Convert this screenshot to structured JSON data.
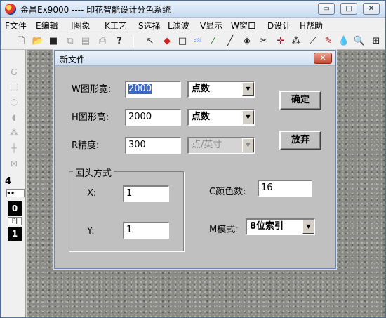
{
  "app": {
    "title": "金昌Ex9000 ---- 印花智能设计分色系统",
    "window_controls": {
      "minimize": "▭",
      "maximize": "□",
      "close": "✕"
    }
  },
  "menu": [
    {
      "label": "F文件"
    },
    {
      "label": "E编辑"
    },
    {
      "label": "I图象"
    },
    {
      "label": "K工艺"
    },
    {
      "label": "S选择"
    },
    {
      "label": "L滤波"
    },
    {
      "label": "V显示"
    },
    {
      "label": "W窗口"
    },
    {
      "label": "D设计"
    },
    {
      "label": "H帮助"
    }
  ],
  "toolbar": {
    "icons": [
      "new-file-icon",
      "open-folder-icon",
      "save-icon",
      "copy-icon",
      "paste-icon",
      "print-icon",
      "help-icon",
      "pointer-icon",
      "eraser-icon",
      "rectangle-icon",
      "brush-icon",
      "pen-icon",
      "line-icon",
      "fill-icon",
      "scissors-icon",
      "crosshair-icon",
      "spray-icon",
      "knife-icon",
      "pencil-icon",
      "dropper-icon",
      "zoom-icon",
      "grid-icon"
    ]
  },
  "side_panel": {
    "first_tool_label": "G",
    "brush_size": "4",
    "value_a": "0",
    "pl_label": "P|",
    "value_b": "1"
  },
  "dialog": {
    "title": "新文件",
    "close_label": "✕",
    "width_label": "W图形宽:",
    "width_value": "2000",
    "width_unit": "点数",
    "height_label": "H图形高:",
    "height_value": "2000",
    "height_unit": "点数",
    "precision_label": "R精度:",
    "precision_value": "300",
    "precision_unit": "点/英寸",
    "ok_label": "确定",
    "cancel_label": "放弃",
    "repeat_group_title": "回头方式",
    "x_label": "X:",
    "x_value": "1",
    "y_label": "Y:",
    "y_value": "1",
    "colors_label": "C颜色数:",
    "colors_value": "16",
    "mode_label": "M模式:",
    "mode_value": "8位索引"
  },
  "colors": {
    "title_gradient_top": "#e9f1fb",
    "dialog_face": "#c0c0c0",
    "selection": "#3a67c3",
    "close_red": "#c44a32"
  }
}
